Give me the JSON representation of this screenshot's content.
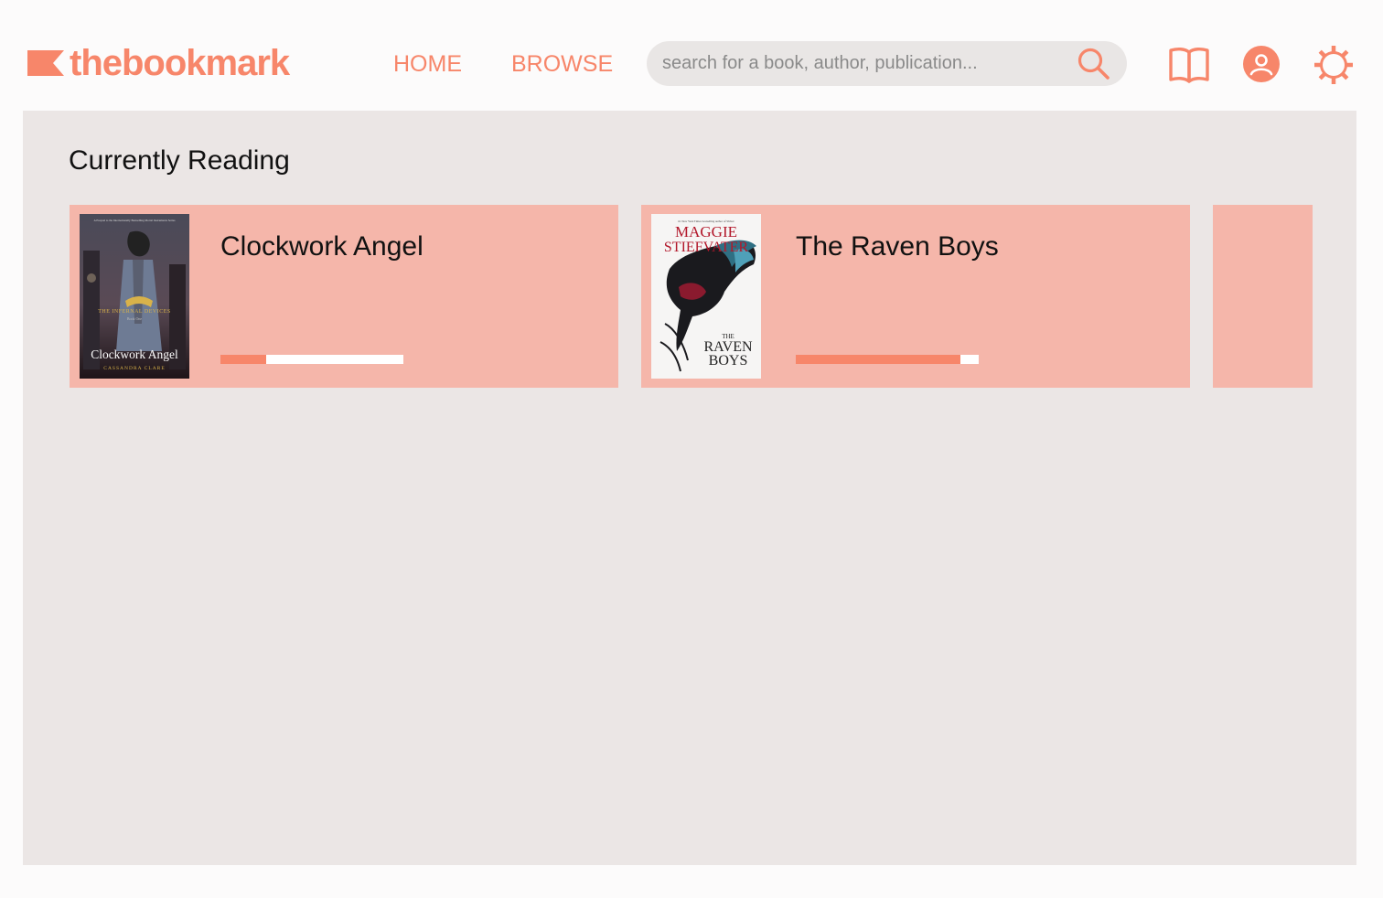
{
  "app": {
    "logo_text": "thebookmark",
    "accent_color": "#f7866a"
  },
  "nav": {
    "home_label": "HOME",
    "browse_label": "BROWSE"
  },
  "search": {
    "placeholder": "search for a book, author, publication..."
  },
  "header_icons": [
    "book-open-icon",
    "user-icon",
    "gear-icon"
  ],
  "currently_reading": {
    "title": "Currently Reading",
    "books": [
      {
        "title": "Clockwork Angel",
        "progress": 0.25,
        "cover": {
          "top_tagline": "A Prequel to the Internationally Bestselling Mortal Instruments Series",
          "series": "THE INFERNAL DEVICES",
          "book_number": "Book One",
          "title": "Clockwork Angel",
          "author": "CASSANDRA CLARE"
        }
      },
      {
        "title": "The Raven Boys",
        "progress": 0.9,
        "cover": {
          "top_tagline": "#1 New York Times bestselling author of Shiver",
          "author_line1": "MAGGIE",
          "author_line2": "STIEFVATER",
          "title_the": "THE",
          "title_line1": "RAVEN",
          "title_line2": "BOYS"
        }
      }
    ]
  }
}
